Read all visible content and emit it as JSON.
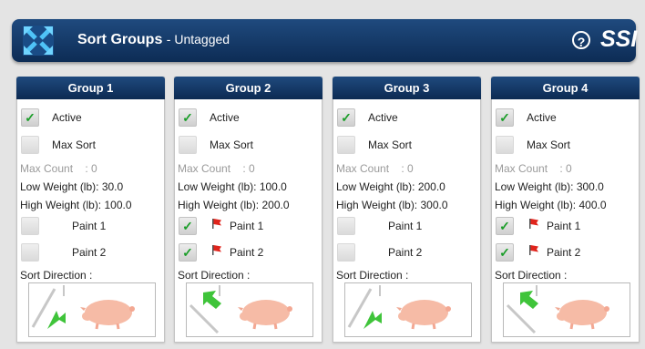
{
  "header": {
    "app_icon": "crossing-arrows-logo-icon",
    "title": "Sort Groups",
    "subtitle": "- Untagged",
    "help_symbol": "?",
    "brand": "SSI"
  },
  "labels": {
    "active": "Active",
    "max_sort": "Max Sort",
    "max_count": "Max Count",
    "low_weight": "Low Weight (lb):",
    "high_weight": "High Weight (lb):",
    "paint1": "Paint 1",
    "paint2": "Paint 2",
    "sort_direction": "Sort Direction :"
  },
  "groups": [
    {
      "title": "Group 1",
      "active": true,
      "max_sort": false,
      "max_count": ": 0",
      "low_weight": "30.0",
      "high_weight": "100.0",
      "paint1": false,
      "paint2": false,
      "direction": "left"
    },
    {
      "title": "Group 2",
      "active": true,
      "max_sort": false,
      "max_count": ": 0",
      "low_weight": "100.0",
      "high_weight": "200.0",
      "paint1": true,
      "paint2": true,
      "direction": "right"
    },
    {
      "title": "Group 3",
      "active": true,
      "max_sort": false,
      "max_count": ": 0",
      "low_weight": "200.0",
      "high_weight": "300.0",
      "paint1": false,
      "paint2": false,
      "direction": "left"
    },
    {
      "title": "Group 4",
      "active": true,
      "max_sort": false,
      "max_count": ": 0",
      "low_weight": "300.0",
      "high_weight": "400.0",
      "paint1": true,
      "paint2": true,
      "direction": "right"
    }
  ],
  "colors": {
    "header": "#0d2c55",
    "check": "#1c9e2a",
    "arrow": "#3fc43a",
    "flag": "#e0241c",
    "pig": "#f6bba6"
  }
}
